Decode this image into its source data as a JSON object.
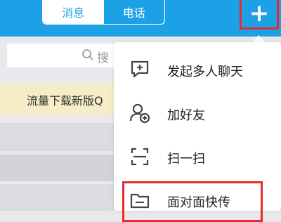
{
  "header": {
    "tabs": [
      {
        "label": "消息",
        "active": true
      },
      {
        "label": "电话",
        "active": false
      }
    ],
    "add_button_label": "+"
  },
  "background": {
    "search_placeholder": "搜",
    "banner_text": "流量下载新版Q"
  },
  "menu": {
    "items": [
      {
        "label": "发起多人聊天",
        "icon": "chat-plus-icon"
      },
      {
        "label": "加好友",
        "icon": "add-friend-icon"
      },
      {
        "label": "扫一扫",
        "icon": "scan-icon"
      },
      {
        "label": "面对面快传",
        "icon": "folder-transfer-icon"
      }
    ]
  },
  "colors": {
    "header_blue": "#1ca0e6",
    "highlight_red": "#e52b2b",
    "icon_gray": "#444444"
  }
}
